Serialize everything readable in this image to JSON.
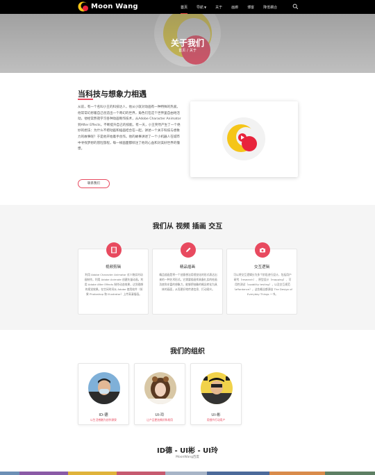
{
  "nav": {
    "brand": "Moon Wang",
    "menu": [
      {
        "label": "首页",
        "active": true,
        "caret": false
      },
      {
        "label": "导航",
        "active": false,
        "caret": true
      },
      {
        "label": "关于",
        "active": false,
        "caret": false
      },
      {
        "label": "画廊",
        "active": false,
        "caret": false
      },
      {
        "label": "博客",
        "active": false,
        "caret": false
      },
      {
        "label": "降低耦合",
        "active": false,
        "caret": false
      }
    ],
    "search_icon": "search-icon"
  },
  "hero": {
    "title": "关于我们",
    "crumb_home": "首页",
    "crumb_current": "关于"
  },
  "about": {
    "title": "当科技与想象力相遇",
    "paragraph": "从前，有一个名叫小王的科技达人，他从小就对动画有一种特殊的热爱。他常常幻想着自己创造出一个奇幻的世界，角色们在这个世界里自由地活动。他经常熬夜学习各种动画制作技术，从Adobe Character Animator到After Effects，不断提升自己的技能。有一天，小王突然产生了一个绝妙的想法：为什么不把动画和插画结合在一起，讲述一个关于科技与想象力的故事呢？于是他开始着手创作。他的故事讲述了一个小机器人在城市中寻找梦想的冒险旅程，每一帧画面都倾注了他的心血和对美好世界的憧憬。",
    "button": "联系我们"
  },
  "services": {
    "title": "我们从 视频 插画 交互",
    "cards": [
      {
        "name": "视频剪辑",
        "icon": "film-icon",
        "desc": "利用 Adobe Character Animator 对人物实时动画制作，利用 Adobe Animate 创建矢量动画。利用 Adobe After Effects 制作动态效果，达到理想的视觉效果。在空闲时间从 Adobe 使用软件（如果 Photoshop 和 Illustrator）上传高清插画。"
      },
      {
        "name": "精品插画",
        "icon": "pencil-icon",
        "desc": "精品插画是将一个创意想法用视觉化的形式表达出来的一种艺术形式。它需要插画师具备扎实的绘画功底和丰富的想象力，能够把抽象的概念转化为具体的画面，从而更好地传递信息、打动观众。"
      },
      {
        "name": "交互逻辑",
        "icon": "camera-icon",
        "desc": "可以将交互逻辑分为多个阶段进行设计，包括用户研究（research）、原型设计（mapping）、可用性测试（usability testing），以及交互规范（affordance），这些概念都源自 The Design of Everyday Things 一书。"
      }
    ]
  },
  "org": {
    "title": "我们的组织",
    "members": [
      {
        "name": "ID-德",
        "role": "以生活感触为创作源泉"
      },
      {
        "name": "UI-玲",
        "role": "让产品更加美好和易用"
      },
      {
        "name": "UI-彬",
        "role": "用细节打动用户"
      }
    ]
  },
  "bottom": {
    "title": "ID德 - UI彬 - UI玲",
    "subtitle": "MoonWang百度"
  },
  "colors": {
    "accent": "#e84a5f",
    "brand_yellow": "#f5c518",
    "brand_red": "#e8243c",
    "nav_bg": "#000000"
  }
}
